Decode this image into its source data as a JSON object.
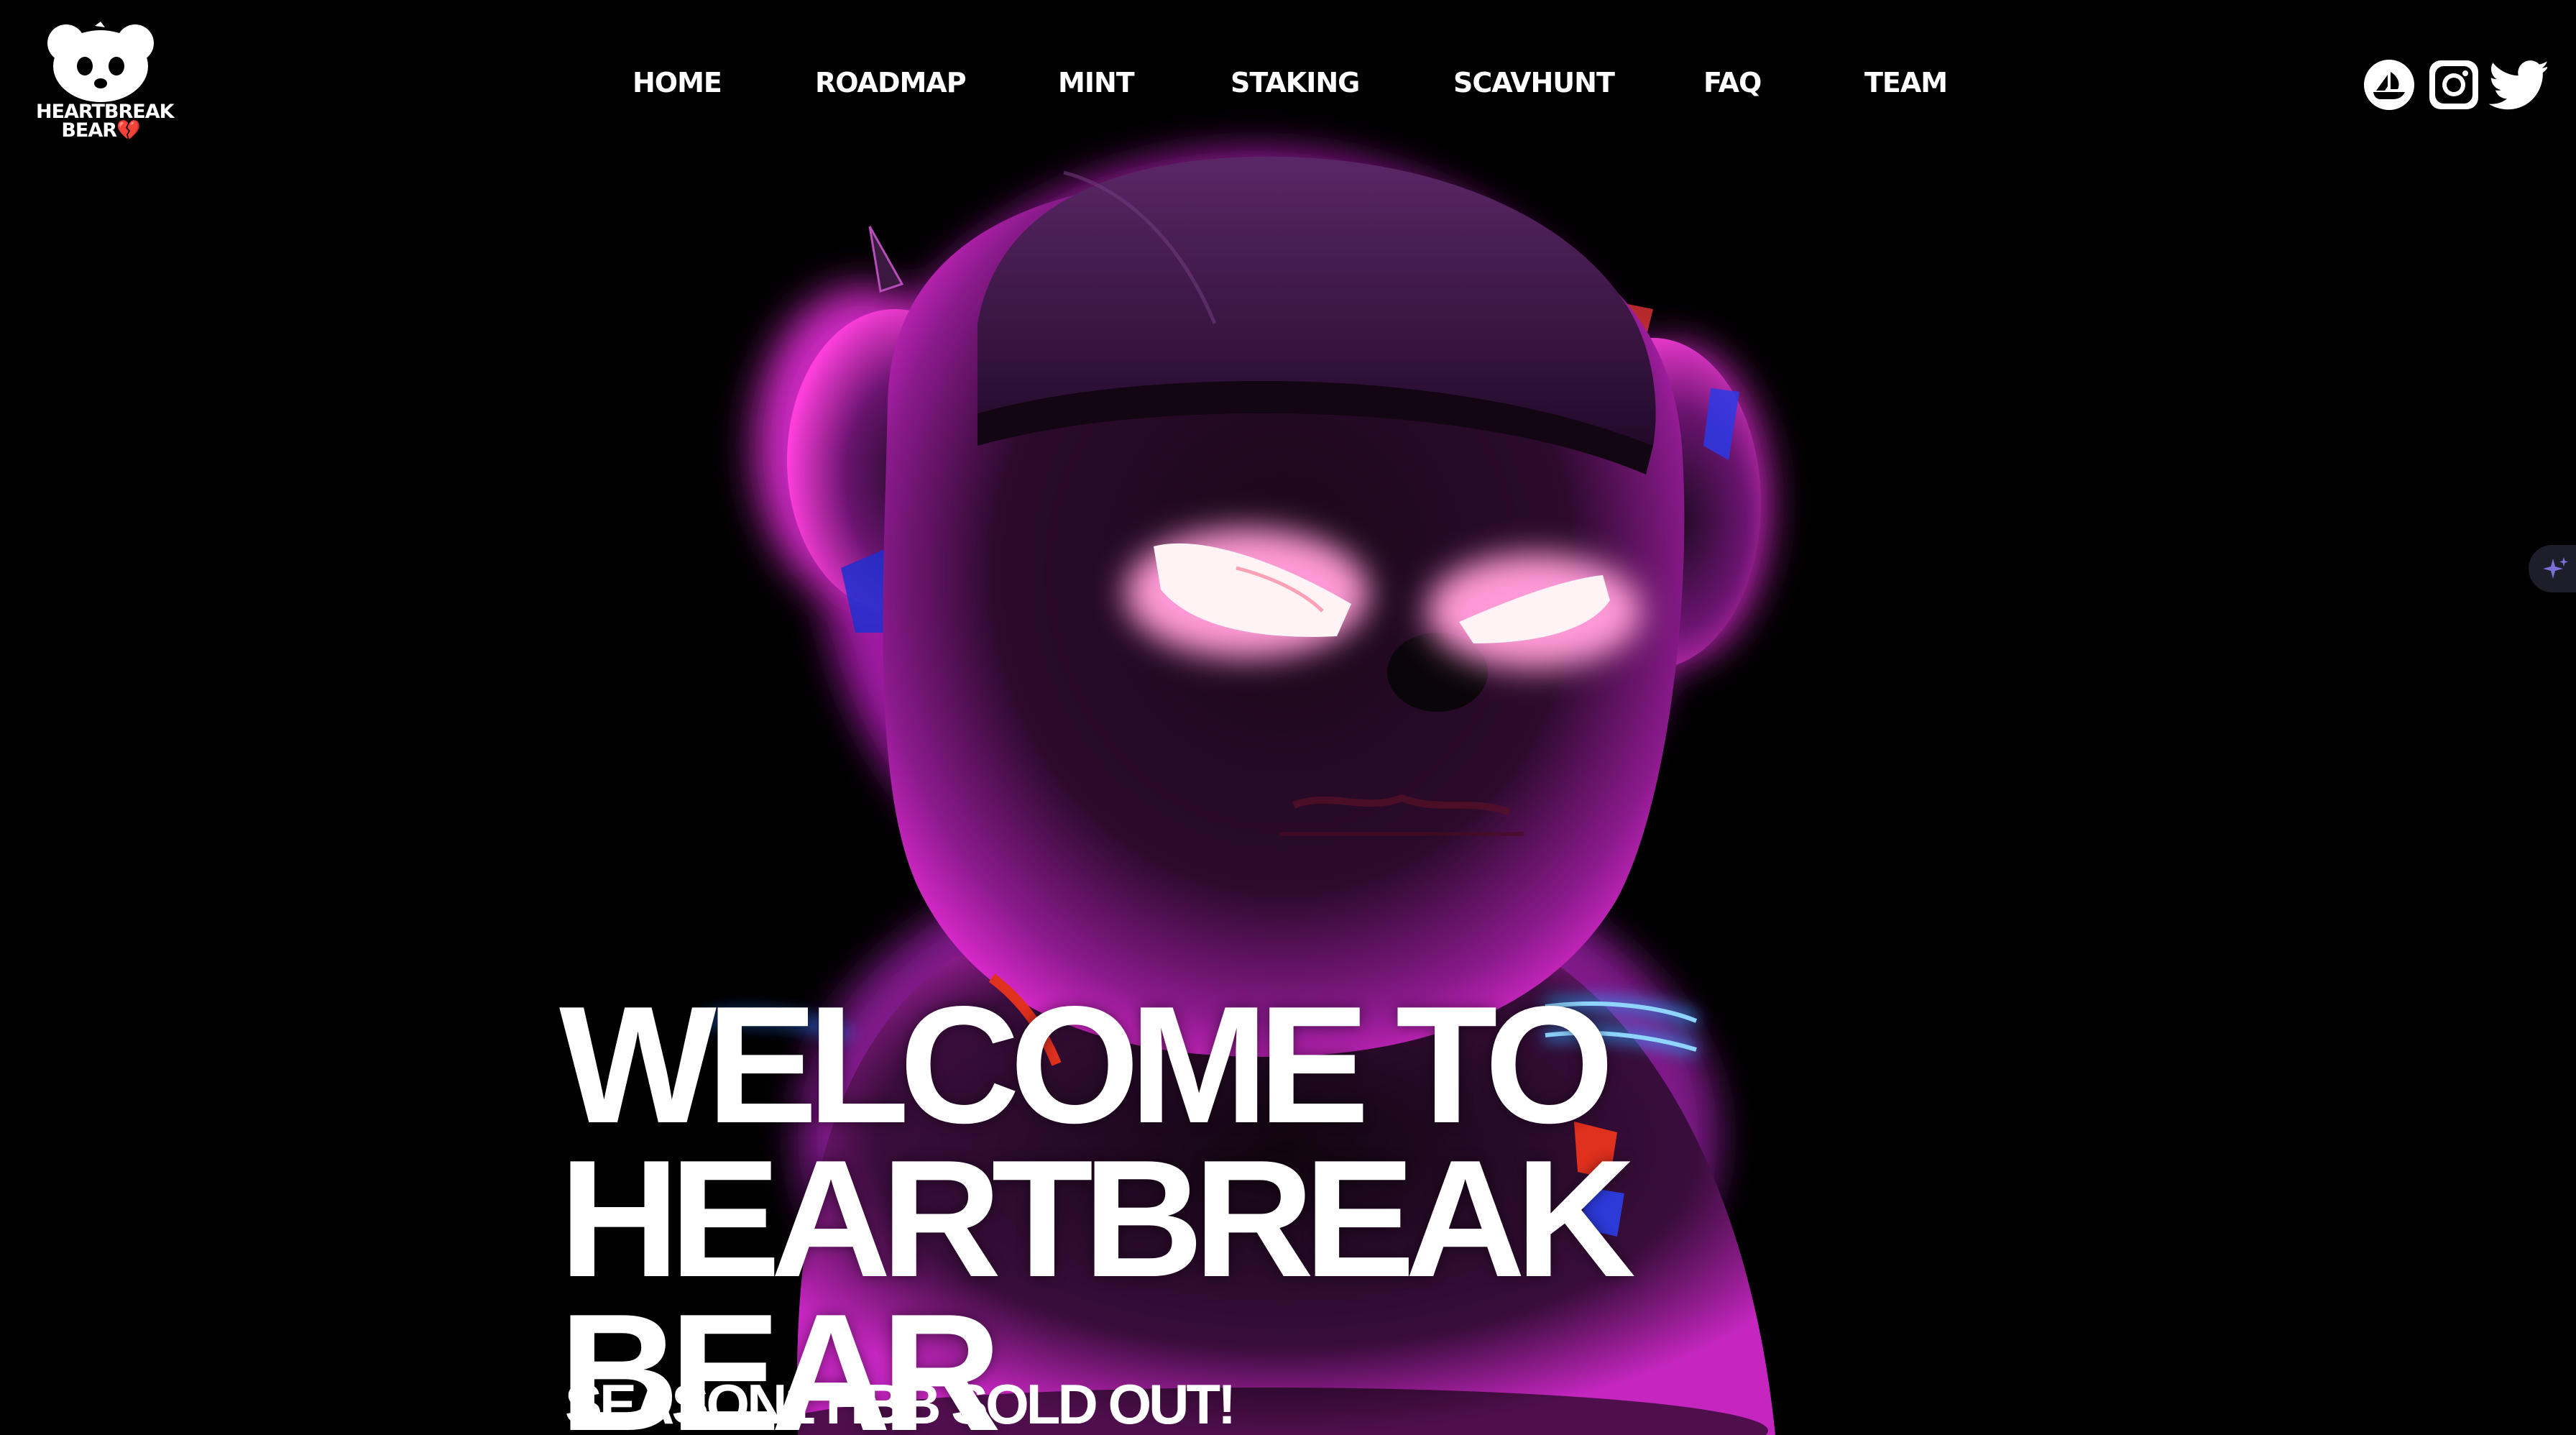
{
  "brand": {
    "logo_line1": "HEARTBREAK",
    "logo_line2": "BEAR💔"
  },
  "nav": {
    "items": [
      {
        "label": "HOME"
      },
      {
        "label": "ROADMAP"
      },
      {
        "label": "MINT"
      },
      {
        "label": "STAKING"
      },
      {
        "label": "SCAVHUNT"
      },
      {
        "label": "FAQ"
      },
      {
        "label": "TEAM"
      }
    ]
  },
  "social": {
    "icons": [
      "opensea-icon",
      "instagram-icon",
      "twitter-icon"
    ]
  },
  "hero": {
    "title_line1": "WELCOME TO",
    "title_line2": "HEARTBREAK",
    "title_line3": "BEAR",
    "subtitle": "SEASON1 HBB SOLD OUT!"
  },
  "side_tab": {
    "icon": "sparkle-icon"
  },
  "colors": {
    "background": "#000000",
    "text": "#ffffff",
    "glow_pink": "#ff2fd0",
    "glow_purple": "#7a1a9e",
    "eye_glow": "#ffe6ee",
    "side_tab_bg": "#1e1d2a",
    "sparkle": "#7b6fd8"
  }
}
